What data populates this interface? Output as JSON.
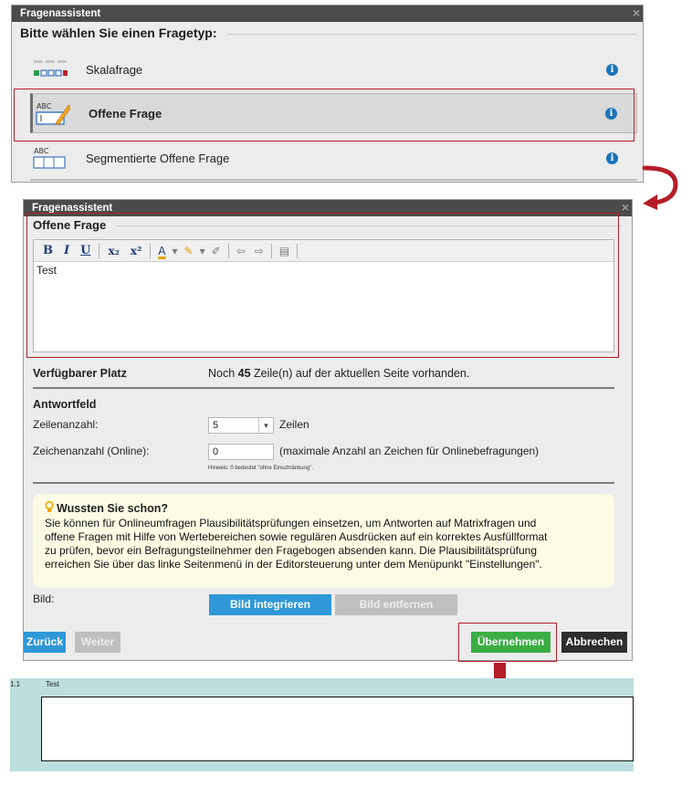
{
  "wizard1": {
    "title": "Fragenassistent",
    "legend": "Bitte wählen Sie einen Fragetyp:",
    "types": [
      {
        "label": "Skalafrage",
        "icon": "scale-question-icon"
      },
      {
        "label": "Offene Frage",
        "icon": "open-question-icon"
      },
      {
        "label": "Segmentierte Offene Frage",
        "icon": "segmented-question-icon"
      }
    ],
    "info_glyph": "i",
    "close_glyph": "×"
  },
  "wizard2": {
    "title": "Fragenassistent",
    "legend": "Offene Frage",
    "toolbar": {
      "bold": "B",
      "italic": "I",
      "underline": "U",
      "subscript": "x₂",
      "superscript": "x²",
      "font_color": "A",
      "highlight": "✎",
      "clear_format": "✐",
      "undo": "⇦",
      "redo": "⇨",
      "paste": "▤",
      "dropdown": "▾"
    },
    "editor_text": "Test",
    "available_label": "Verfügbarer Platz",
    "available_prefix": "Noch ",
    "available_count": "45",
    "available_suffix": " Zeile(n) auf der aktuellen Seite vorhanden.",
    "answer_heading": "Antwortfeld",
    "rows_label": "Zeilenanzahl:",
    "rows_value": "5",
    "rows_unit": "Zeilen",
    "chars_label": "Zeichenanzahl (Online):",
    "chars_value": "0",
    "chars_note": "(maximale Anzahl an Zeichen für Onlinebefragungen)",
    "chars_hint": "Hinweis: 0 bedeutet \"ohne Einschränkung\".",
    "tip_title": "Wussten Sie schon?",
    "tip_lines": [
      "Sie können für Onlineumfragen Plausibilitätsprüfungen einsetzen, um Antworten auf Matrixfragen und",
      "offene Fragen mit Hilfe von Wertebereichen sowie regulären Ausdrücken auf ein korrektes Ausfüllformat",
      "zu prüfen, bevor ein Befragungsteilnehmer den Fragebogen absenden kann. Die Plausibilitätsprüfung",
      "erreichen Sie über das linke Seitenmenü in der Editorsteuerung unter dem Menüpunkt \"Einstellungen\"."
    ],
    "image_label": "Bild:",
    "btn_integrate": "Bild integrieren",
    "btn_remove": "Bild entfernen",
    "btn_back": "Zurück",
    "btn_next": "Weiter",
    "btn_apply": "Übernehmen",
    "btn_cancel": "Abbrechen"
  },
  "result": {
    "number": "1.1",
    "question": "Test"
  },
  "colors": {
    "annotation": "#b41e28",
    "accent_blue": "#2f98d7",
    "apply_green": "#3aae43",
    "result_bg": "#bcdedd"
  }
}
